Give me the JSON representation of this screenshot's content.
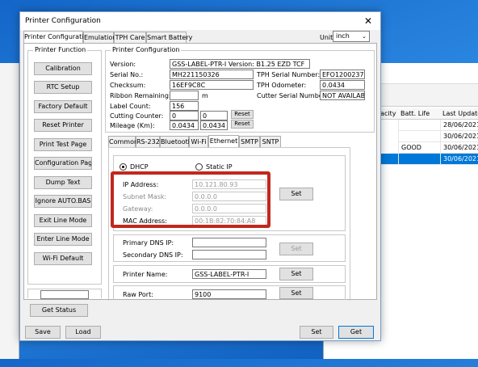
{
  "background_window": {
    "columns": [
      "pacity",
      "Batt. Life",
      "Last Update"
    ],
    "rows": [
      {
        "batt": "",
        "last": "28/06/2021 14:",
        "selected": false
      },
      {
        "batt": "",
        "last": "30/06/2021 12:",
        "selected": false
      },
      {
        "batt": "GOOD",
        "last": "30/06/2021 12:",
        "selected": false
      },
      {
        "batt": "",
        "last": "30/06/2021 13:",
        "selected": true
      }
    ]
  },
  "dialog": {
    "title": "Printer Configuration",
    "close": "✕",
    "tabs": [
      "Printer Configuration",
      "Emulation",
      "TPH Care",
      "Smart Battery"
    ],
    "unit_label": "Unit:",
    "unit_value": "inch",
    "printer_function": {
      "title": "Printer Function",
      "buttons": [
        "Calibration",
        "RTC Setup",
        "Factory Default",
        "Reset Printer",
        "Print Test Page",
        "Configuration Page",
        "Dump Text",
        "Ignore AUTO.BAS",
        "Exit Line Mode",
        "Enter Line Mode",
        "Wi-Fi Default"
      ],
      "status_value": "",
      "get_status": "Get Status"
    },
    "printer_configuration": {
      "title": "Printer Configuration",
      "version_label": "Version:",
      "version": "GSS-LABEL-PTR-I Version: B1.25 EZD TCF",
      "serial_label": "Serial No.:",
      "serial": "MH221150326",
      "tph_serial_label": "TPH Serial Number:",
      "tph_serial": "EFO1200237",
      "checksum_label": "Checksum:",
      "checksum": "16EF9C8C",
      "tph_odometer_label": "TPH Odometer:",
      "tph_odometer": "0.0434",
      "ribbon_label": "Ribbon Remaining:",
      "ribbon": "",
      "ribbon_unit": "m",
      "cutter_label": "Cutter Serial Number:",
      "cutter": "NOT AVAILABLE",
      "label_count_label": "Label Count:",
      "label_count": "156",
      "cutting_label": "Cutting Counter:",
      "cutting_1": "0",
      "cutting_2": "0",
      "mileage_label": "Mileage (Km):",
      "mileage_1": "0.0434",
      "mileage_2": "0.0434",
      "reset": "Reset"
    },
    "comm_tabs": [
      "Common",
      "RS-232",
      "Bluetooth",
      "Wi-Fi",
      "Ethernet",
      "SMTP",
      "SNTP"
    ],
    "ethernet": {
      "dhcp": "DHCP",
      "static_ip": "Static IP",
      "ip_label": "IP Address:",
      "ip": "10.121.80.93",
      "subnet_label": "Subnet Mask:",
      "subnet": "0.0.0.0",
      "gateway_label": "Gateway:",
      "gateway": "0.0.0.0",
      "mac_label": "MAC Address:",
      "mac": "00:1B:82:70:84:A8",
      "set": "Set",
      "dns1_label": "Primary DNS IP:",
      "dns1": "",
      "dns2_label": "Secondary DNS IP:",
      "dns2": "",
      "printer_name_label": "Printer Name:",
      "printer_name": "GSS-LABEL-PTR-I",
      "raw_port_label": "Raw Port:",
      "raw_port": "9100"
    },
    "footer": {
      "save": "Save",
      "load": "Load",
      "set": "Set",
      "get": "Get"
    }
  },
  "colors": {
    "highlight": "#c0281e",
    "selection": "#0078d7"
  }
}
